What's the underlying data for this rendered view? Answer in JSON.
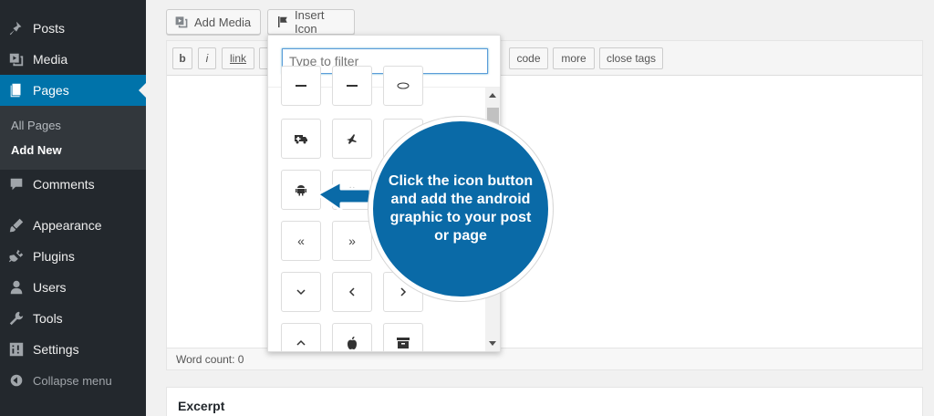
{
  "sidebar": {
    "items": [
      {
        "label": "Posts",
        "icon": "pin-icon"
      },
      {
        "label": "Media",
        "icon": "media-icon"
      },
      {
        "label": "Pages",
        "icon": "pages-icon"
      },
      {
        "label": "Comments",
        "icon": "comment-icon"
      },
      {
        "label": "Appearance",
        "icon": "brush-icon"
      },
      {
        "label": "Plugins",
        "icon": "plug-icon"
      },
      {
        "label": "Users",
        "icon": "user-icon"
      },
      {
        "label": "Tools",
        "icon": "wrench-icon"
      },
      {
        "label": "Settings",
        "icon": "settings-icon"
      }
    ],
    "submenu": [
      "All Pages",
      "Add New"
    ],
    "collapse_label": "Collapse menu"
  },
  "toolbar": {
    "add_media": "Add Media",
    "insert_icon": "Insert Icon"
  },
  "quicktags": [
    "b",
    "i",
    "link",
    "code",
    "more",
    "close tags"
  ],
  "popup": {
    "filter_placeholder": "Type to filter"
  },
  "editor": {
    "word_count": "Word count: 0"
  },
  "excerpt": {
    "title": "Excerpt"
  },
  "callout": {
    "text": "Click the icon button and add the android graphic to your post or page"
  },
  "colors": {
    "sidebar_bg": "#23282d",
    "active": "#0073aa",
    "callout": "#0a6aa7"
  }
}
